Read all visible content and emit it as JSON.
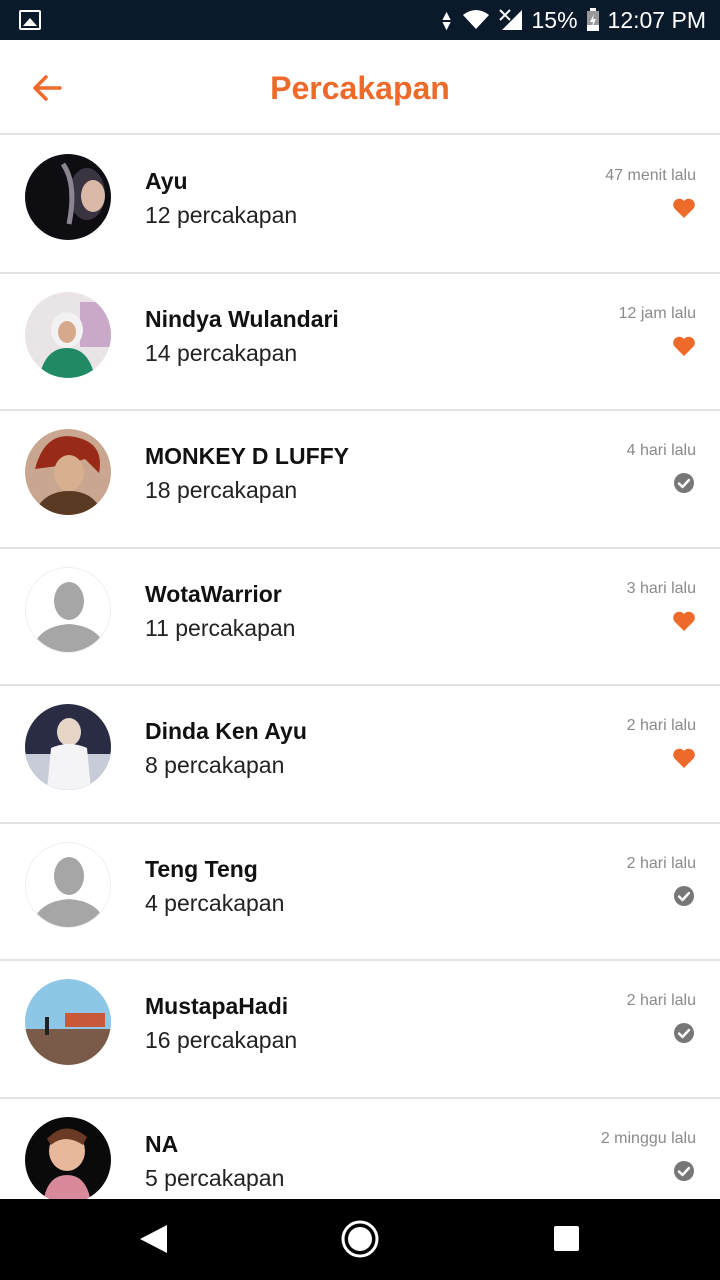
{
  "status_bar": {
    "battery": "15%",
    "time": "12:07 PM"
  },
  "header": {
    "title": "Percakapan"
  },
  "conversations": [
    {
      "name": "Ayu",
      "count": "12 percakapan",
      "time": "47 menit lalu",
      "status": "heart"
    },
    {
      "name": "Nindya Wulandari",
      "count": "14 percakapan",
      "time": "12 jam lalu",
      "status": "heart"
    },
    {
      "name": "MONKEY D LUFFY",
      "count": "18 percakapan",
      "time": "4 hari lalu",
      "status": "check"
    },
    {
      "name": "WotaWarrior",
      "count": "11 percakapan",
      "time": "3 hari lalu",
      "status": "heart"
    },
    {
      "name": "Dinda Ken Ayu",
      "count": "8 percakapan",
      "time": "2 hari lalu",
      "status": "heart"
    },
    {
      "name": "Teng Teng",
      "count": "4 percakapan",
      "time": "2 hari lalu",
      "status": "check"
    },
    {
      "name": "MustapaHadi",
      "count": "16 percakapan",
      "time": "2 hari lalu",
      "status": "check"
    },
    {
      "name": "NA",
      "count": "5 percakapan",
      "time": "2 minggu lalu",
      "status": "check"
    }
  ],
  "colors": {
    "accent": "#ee6a2a",
    "heart": "#ee6a2a",
    "check": "#777777",
    "status_bar": "#0a1a2a"
  },
  "icons": {
    "back": "arrow-left-icon",
    "favorite": "heart-icon",
    "read": "check-circle-icon",
    "nav_back": "triangle-back-icon",
    "nav_home": "circle-home-icon",
    "nav_recents": "square-recents-icon"
  }
}
